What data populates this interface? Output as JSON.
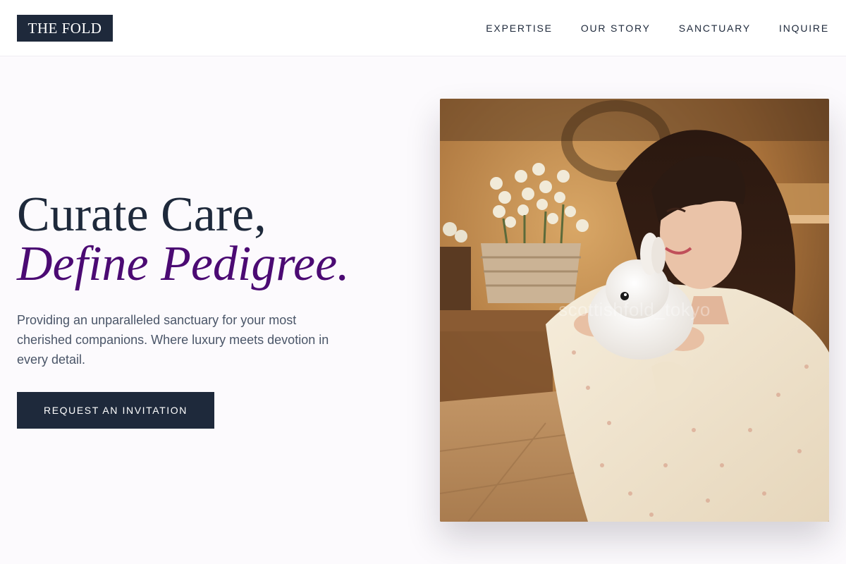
{
  "brand": {
    "logo_text": "THE FOLD"
  },
  "nav": {
    "items": [
      {
        "label": "EXPERTISE"
      },
      {
        "label": "OUR STORY"
      },
      {
        "label": "SANCTUARY"
      },
      {
        "label": "INQUIRE"
      }
    ]
  },
  "hero": {
    "headline_line1": "Curate Care,",
    "headline_line2": "Define Pedigree.",
    "subtitle": "Providing an unparalleled sanctuary for your most cherished companions. Where luxury meets devotion in every detail.",
    "cta_label": "REQUEST AN INVITATION",
    "image_watermark": "scottishfold_tokyo"
  },
  "colors": {
    "primary": "#1e293b",
    "accent": "#4b0a73",
    "background": "#fcfafd"
  }
}
